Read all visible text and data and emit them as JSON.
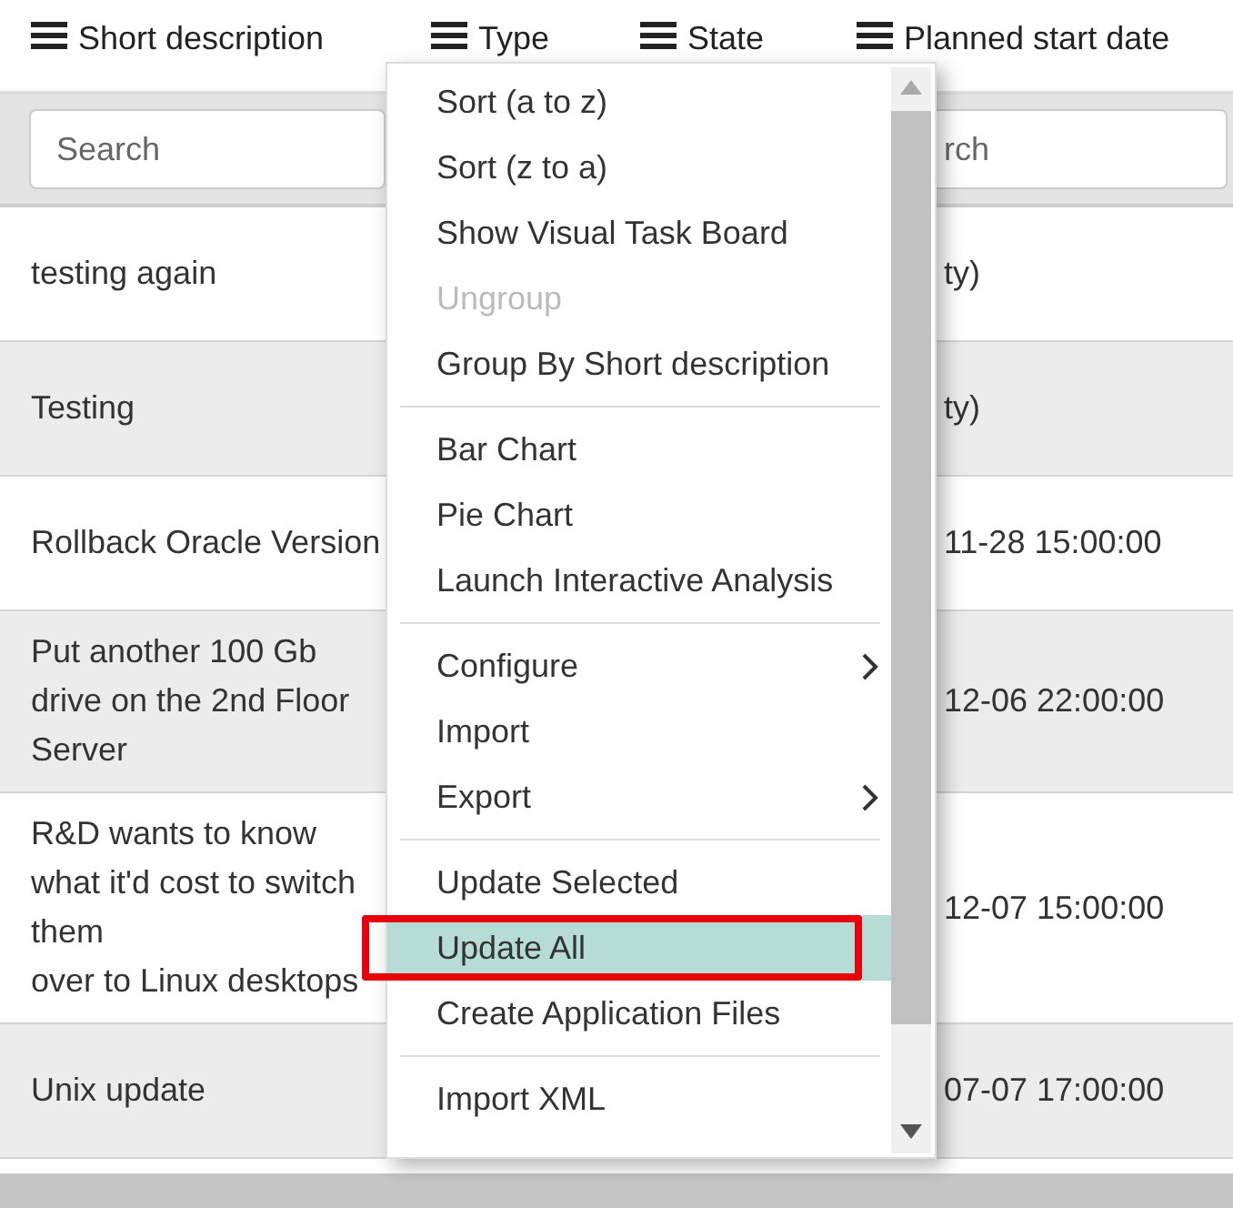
{
  "table": {
    "columns": [
      {
        "label": "Short description"
      },
      {
        "label": "Type"
      },
      {
        "label": "State"
      },
      {
        "label": "Planned start date"
      }
    ],
    "search": [
      {
        "placeholder": "Search"
      },
      {
        "placeholder": "rch"
      }
    ],
    "rows": [
      {
        "short_description": "testing again",
        "planned_start_date": "ty)"
      },
      {
        "short_description": "Testing",
        "planned_start_date": "ty)"
      },
      {
        "short_description": "Rollback Oracle Version",
        "planned_start_date": "11-28 15:00:00"
      },
      {
        "short_description": "Put another 100 Gb\ndrive on the 2nd Floor\nServer",
        "planned_start_date": "12-06 22:00:00"
      },
      {
        "short_description": "R&D wants to know\nwhat it'd cost to switch\nthem\nover to Linux desktops",
        "planned_start_date": "12-07 15:00:00"
      },
      {
        "short_description": "Unix update",
        "planned_start_date": "07-07 17:00:00"
      }
    ]
  },
  "context_menu": {
    "items": [
      {
        "kind": "item",
        "label": "Sort (a to z)",
        "disabled": false,
        "submenu": false,
        "selected": false
      },
      {
        "kind": "item",
        "label": "Sort (z to a)",
        "disabled": false,
        "submenu": false,
        "selected": false
      },
      {
        "kind": "item",
        "label": "Show Visual Task Board",
        "disabled": false,
        "submenu": false,
        "selected": false
      },
      {
        "kind": "item",
        "label": "Ungroup",
        "disabled": true,
        "submenu": false,
        "selected": false
      },
      {
        "kind": "item",
        "label": "Group By Short description",
        "disabled": false,
        "submenu": false,
        "selected": false
      },
      {
        "kind": "separator"
      },
      {
        "kind": "item",
        "label": "Bar Chart",
        "disabled": false,
        "submenu": false,
        "selected": false
      },
      {
        "kind": "item",
        "label": "Pie Chart",
        "disabled": false,
        "submenu": false,
        "selected": false
      },
      {
        "kind": "item",
        "label": "Launch Interactive Analysis",
        "disabled": false,
        "submenu": false,
        "selected": false
      },
      {
        "kind": "separator"
      },
      {
        "kind": "item",
        "label": "Configure",
        "disabled": false,
        "submenu": true,
        "selected": false
      },
      {
        "kind": "item",
        "label": "Import",
        "disabled": false,
        "submenu": false,
        "selected": false
      },
      {
        "kind": "item",
        "label": "Export",
        "disabled": false,
        "submenu": true,
        "selected": false
      },
      {
        "kind": "separator"
      },
      {
        "kind": "item",
        "label": "Update Selected",
        "disabled": false,
        "submenu": false,
        "selected": false
      },
      {
        "kind": "item",
        "label": "Update All",
        "disabled": false,
        "submenu": false,
        "selected": true,
        "annotated": true
      },
      {
        "kind": "item",
        "label": "Create Application Files",
        "disabled": false,
        "submenu": false,
        "selected": false
      },
      {
        "kind": "separator"
      },
      {
        "kind": "item",
        "label": "Import XML",
        "disabled": false,
        "submenu": false,
        "selected": false
      }
    ]
  }
}
